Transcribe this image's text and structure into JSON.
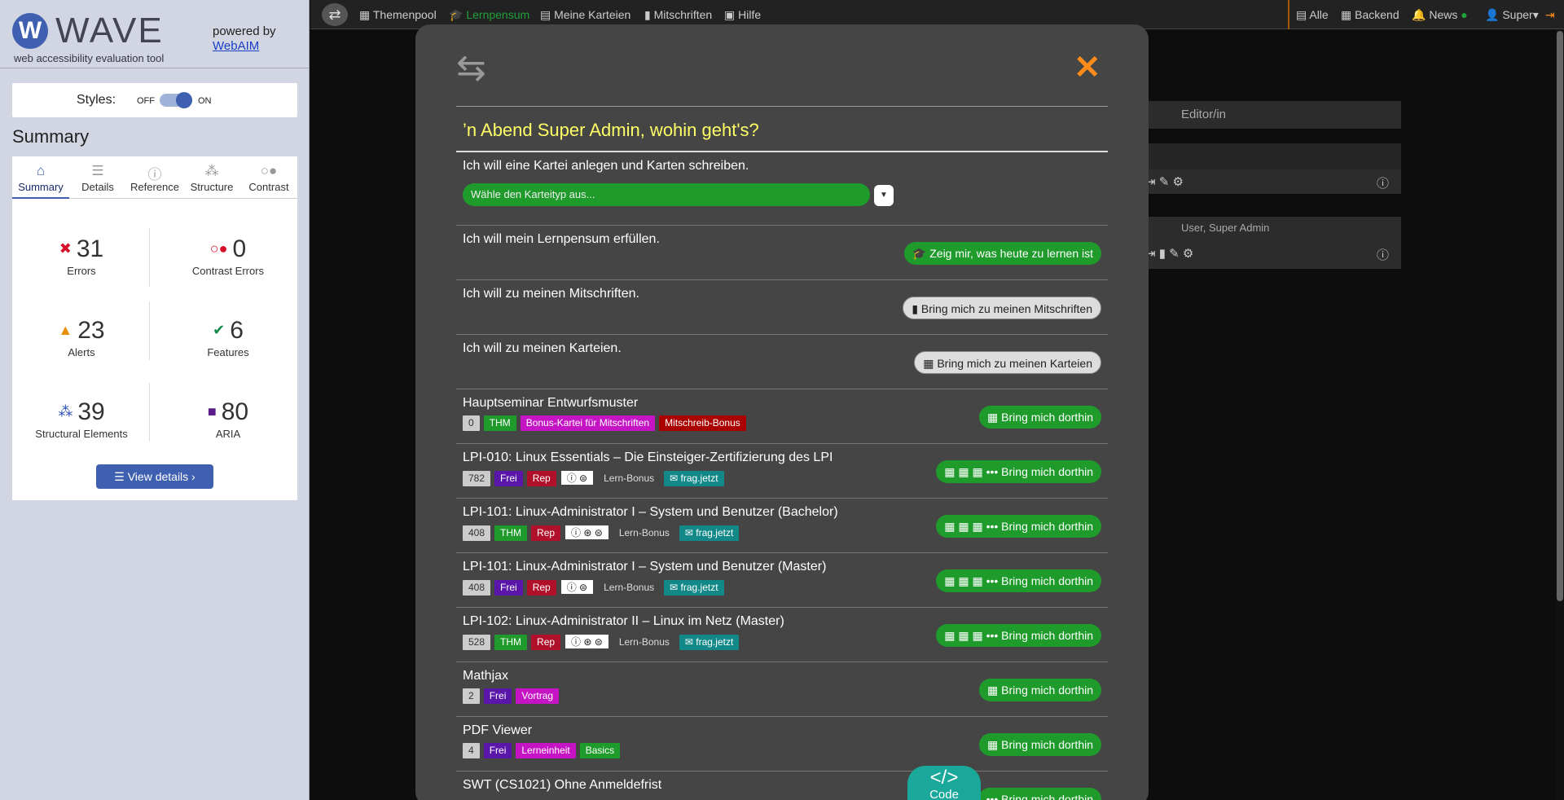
{
  "wave": {
    "logo_letter": "W",
    "name": "WAVE",
    "subtitle": "web accessibility evaluation tool",
    "powered_by": "powered by",
    "webaim": "WebAIM",
    "styles_label": "Styles:",
    "off": "OFF",
    "on": "ON",
    "summary_title": "Summary",
    "tabs": [
      {
        "label": "Summary",
        "icon": "home-icon"
      },
      {
        "label": "Details",
        "icon": "list-icon"
      },
      {
        "label": "Reference",
        "icon": "info-icon"
      },
      {
        "label": "Structure",
        "icon": "structure-icon"
      },
      {
        "label": "Contrast",
        "icon": "contrast-icon"
      }
    ],
    "stats": {
      "errors": {
        "num": "31",
        "label": "Errors",
        "color": "#d6102a"
      },
      "contrast": {
        "num": "0",
        "label": "Contrast Errors",
        "color": "#d6102a"
      },
      "alerts": {
        "num": "23",
        "label": "Alerts",
        "color": "#e8900c"
      },
      "features": {
        "num": "6",
        "label": "Features",
        "color": "#168a4a"
      },
      "structural": {
        "num": "39",
        "label": "Structural Elements",
        "color": "#2b4fb8"
      },
      "aria": {
        "num": "80",
        "label": "ARIA",
        "color": "#5a1a8a"
      }
    },
    "view_details": "View details ›"
  },
  "nav": {
    "items": [
      "Themenpool",
      "Lernpensum",
      "Meine Karteien",
      "Mitschriften",
      "Hilfe"
    ],
    "right": [
      "Alle",
      "Backend",
      "News",
      "Super"
    ],
    "active": "Lernpensum"
  },
  "bg": {
    "editor": "Editor/in",
    "user": "User, Super Admin"
  },
  "modal": {
    "greeting": "’n Abend Super Admin, wohin geht's?",
    "create_text": "Ich will eine Kartei anlegen und Karten schreiben.",
    "select_placeholder": "Wähle den Karteityp aus...",
    "rows_top": [
      {
        "text": "Ich will mein Lernpensum erfüllen.",
        "button": "Zeig mir, was heute zu lernen ist",
        "style": "green"
      },
      {
        "text": "Ich will zu meinen Mitschriften.",
        "button": "Bring mich zu meinen Mitschriften",
        "style": "white"
      },
      {
        "text": "Ich will zu meinen Karteien.",
        "button": "Bring mich zu meinen Karteien",
        "style": "white"
      }
    ],
    "decks": [
      {
        "title": "Hauptseminar Entwurfsmuster",
        "tags": [
          "0",
          "THM",
          "Bonus-Kartei für Mitschriften",
          "Mitschreib-Bonus"
        ],
        "button": "Bring mich dorthin"
      },
      {
        "title": "LPI-010: Linux Essentials – Die Einsteiger-Zertifizierung des LPI",
        "tags": [
          "782",
          "Frei",
          "Rep",
          "ⓘ ⊜",
          "Lern-Bonus",
          "frag.jetzt"
        ],
        "button": "Bring mich dorthin"
      },
      {
        "title": "LPI-101: Linux-Administrator I – System und Benutzer (Bachelor)",
        "tags": [
          "408",
          "THM",
          "Rep",
          "ⓘ ⊛ ⊜",
          "Lern-Bonus",
          "frag.jetzt"
        ],
        "button": "Bring mich dorthin"
      },
      {
        "title": "LPI-101: Linux-Administrator I – System und Benutzer (Master)",
        "tags": [
          "408",
          "Frei",
          "Rep",
          "ⓘ ⊜",
          "Lern-Bonus",
          "frag.jetzt"
        ],
        "button": "Bring mich dorthin"
      },
      {
        "title": "LPI-102: Linux-Administrator II – Linux im Netz (Master)",
        "tags": [
          "528",
          "THM",
          "Rep",
          "ⓘ ⊛ ⊜",
          "Lern-Bonus",
          "frag.jetzt"
        ],
        "button": "Bring mich dorthin"
      },
      {
        "title": "Mathjax",
        "tags": [
          "2",
          "Frei",
          "Vortrag"
        ],
        "button": "Bring mich dorthin"
      },
      {
        "title": "PDF Viewer",
        "tags": [
          "4",
          "Frei",
          "Lerneinheit",
          "Basics"
        ],
        "button": "Bring mich dorthin"
      },
      {
        "title": "SWT (CS1021) Ohne Anmeldefrist",
        "tags": [],
        "button": "Bring mich dorthin"
      }
    ]
  },
  "code_button": {
    "symbol": "</>",
    "label": "Code"
  }
}
